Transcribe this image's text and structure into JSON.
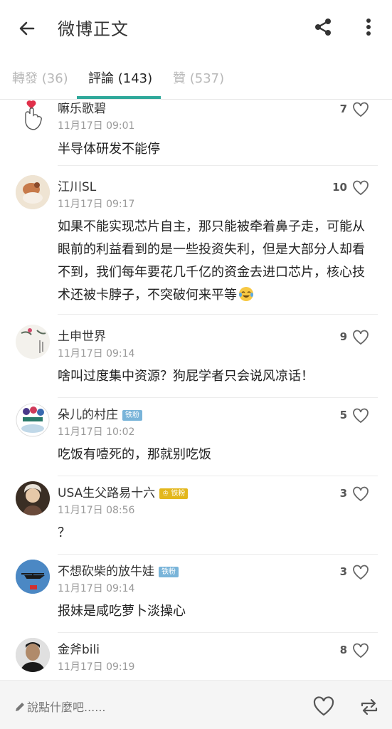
{
  "appbar": {
    "title": "微博正文"
  },
  "tabs": [
    {
      "label": "轉發 (36)"
    },
    {
      "label": "評論 (143)"
    },
    {
      "label": "贊 (537)"
    }
  ],
  "comments": [
    {
      "name": "嘛乐歌碧",
      "time": "11月17日 09:01",
      "likes": "7",
      "text": "半导体研发不能停"
    },
    {
      "name": "江川SL",
      "time": "11月17日 09:17",
      "likes": "10",
      "text": "如果不能实现芯片自主，那只能被牵着鼻子走，可能从眼前的利益看到的是一些投资失利，但是大部分人却看不到，我们每年要花几千亿的资金去进口芯片，核心技术还被卡脖子，不突破何来平等"
    },
    {
      "name": "土申世界",
      "time": "11月17日 09:14",
      "likes": "9",
      "text": "啥叫过度集中资源？狗屁学者只会说风凉话！"
    },
    {
      "name": "朵儿的村庄",
      "badge": "铁粉",
      "time": "11月17日 10:02",
      "likes": "5",
      "text": "吃饭有噎死的，那就别吃饭"
    },
    {
      "name": "USA生父路易十六",
      "badge": "铁粉",
      "time": "11月17日 08:56",
      "likes": "3",
      "text": "？"
    },
    {
      "name": "不想砍柴的放牛娃",
      "badge": "铁粉",
      "time": "11月17日 09:14",
      "likes": "3",
      "text": "报妹是咸吃萝卜淡操心"
    },
    {
      "name": "金斧bili",
      "time": "11月17日 09:19",
      "likes": "8"
    }
  ],
  "bottombar": {
    "placeholder": "說點什麼吧......"
  },
  "colors": {
    "accent": "#2fa89a",
    "badge": "#79b4d9"
  }
}
